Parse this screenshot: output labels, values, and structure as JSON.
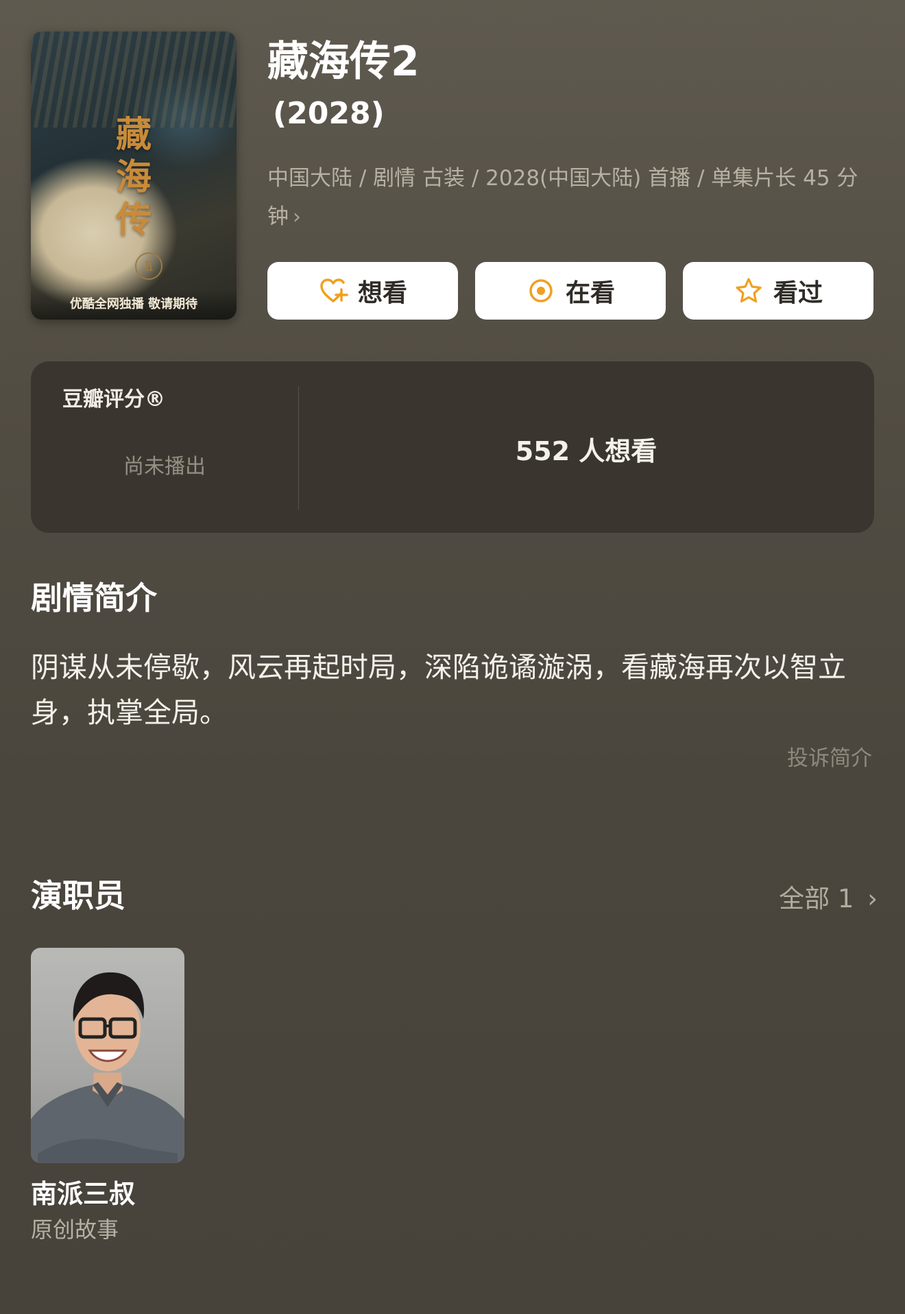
{
  "poster": {
    "title_glyphs": "藏海传",
    "seal": "Ⅱ",
    "caption": "优酷全网独播 敬请期待"
  },
  "header": {
    "title": "藏海传2",
    "year": "(2028)",
    "meta": "中国大陆 / 剧情 古装 / 2028(中国大陆) 首播 / 单集片长 45 分钟",
    "chevron": "›"
  },
  "actions": [
    {
      "label": "想看",
      "icon": "heart-plus-icon"
    },
    {
      "label": "在看",
      "icon": "target-circle-icon"
    },
    {
      "label": "看过",
      "icon": "star-icon"
    }
  ],
  "rating": {
    "label": "豆瓣评分®",
    "status": "尚未播出",
    "want_count": "552 人想看"
  },
  "synopsis": {
    "heading": "剧情简介",
    "text": "阴谋从未停歇，风云再起时局，深陷诡谲漩涡，看藏海再次以智立身，执掌全局。",
    "report_link": "投诉简介"
  },
  "cast": {
    "heading": "演职员",
    "all_link": "全部 1",
    "all_chevron": "›",
    "members": [
      {
        "name": "南派三叔",
        "role": "原创故事"
      }
    ]
  },
  "colors": {
    "background": "#524d43",
    "card": "#3a362f",
    "accent_orange": "#f0a020"
  }
}
